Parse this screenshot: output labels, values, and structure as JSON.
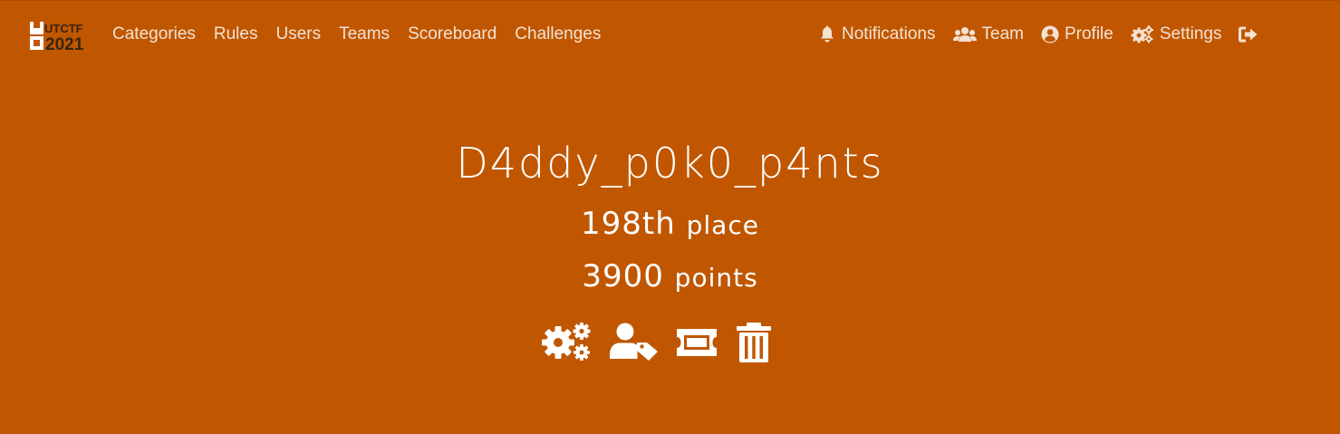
{
  "logo": {
    "line1": "UTCTF",
    "line2": "2021"
  },
  "nav": {
    "left": [
      {
        "label": "Categories"
      },
      {
        "label": "Rules"
      },
      {
        "label": "Users"
      },
      {
        "label": "Teams"
      },
      {
        "label": "Scoreboard"
      },
      {
        "label": "Challenges"
      }
    ],
    "right": {
      "notifications": "Notifications",
      "team": "Team",
      "profile": "Profile",
      "settings": "Settings"
    }
  },
  "user": {
    "name": "D4ddy_p0k0_p4nts",
    "place_value": "198th",
    "place_label": "place",
    "points_value": "3900",
    "points_label": "points"
  },
  "icons": {
    "settings": "cogs-icon",
    "user_tag": "user-tag-icon",
    "award": "ticket-icon",
    "delete": "trash-icon",
    "logout": "sign-out-icon"
  },
  "colors": {
    "background": "#c05700",
    "nav_text": "#f4e2d3",
    "text": "#ffffff"
  }
}
